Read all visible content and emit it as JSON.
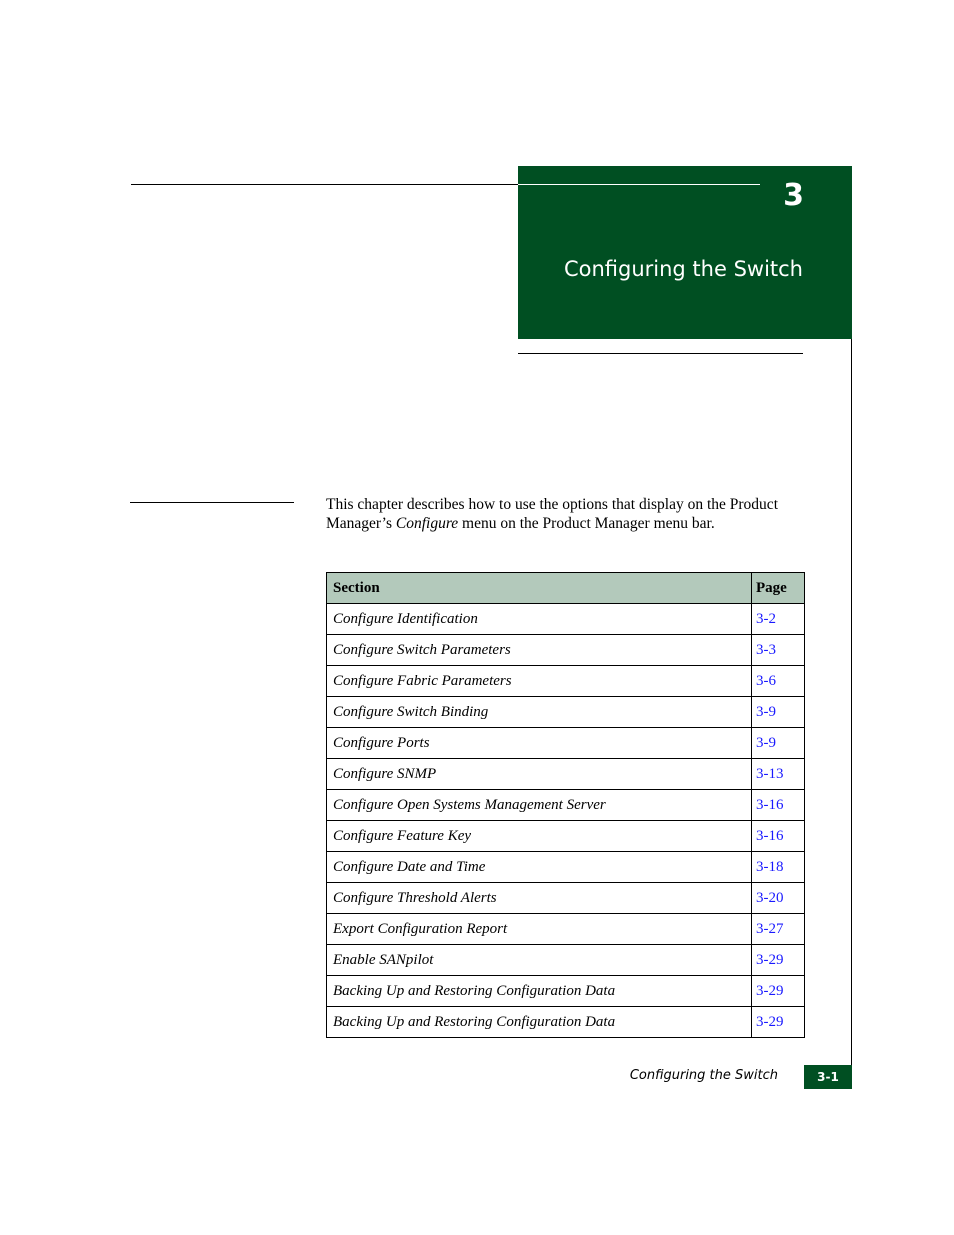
{
  "chapter": {
    "number": "3",
    "title": "Configuring the Switch"
  },
  "intro": {
    "text_before": "This chapter describes how to use the options that display on the Product Manager’s ",
    "emphasis": "Configure",
    "text_after": " menu on the Product Manager menu bar."
  },
  "toc": {
    "headers": {
      "section": "Section",
      "page": "Page"
    },
    "rows": [
      {
        "section": "Configure Identification",
        "page": "3-2"
      },
      {
        "section": "Configure Switch Parameters",
        "page": "3-3"
      },
      {
        "section": "Configure Fabric Parameters",
        "page": "3-6"
      },
      {
        "section": "Configure Switch Binding",
        "page": "3-9"
      },
      {
        "section": "Configure Ports",
        "page": "3-9"
      },
      {
        "section": "Configure SNMP",
        "page": "3-13"
      },
      {
        "section": "Configure Open Systems Management Server",
        "page": "3-16"
      },
      {
        "section": "Configure Feature Key",
        "page": "3-16"
      },
      {
        "section": "Configure Date and Time",
        "page": "3-18"
      },
      {
        "section": "Configure Threshold Alerts",
        "page": "3-20"
      },
      {
        "section": "Export Configuration Report",
        "page": "3-27"
      },
      {
        "section": "Enable SANpilot",
        "page": "3-29"
      },
      {
        "section": "Backing Up and Restoring Configuration Data",
        "page": "3-29"
      },
      {
        "section": "Backing Up and Restoring Configuration Data",
        "page": "3-29"
      }
    ]
  },
  "footer": {
    "running_title": "Configuring the Switch",
    "page_number": "3-1"
  },
  "colors": {
    "brand_green": "#004f22",
    "table_header": "#b3c9bb",
    "link": "#1a1aff"
  }
}
